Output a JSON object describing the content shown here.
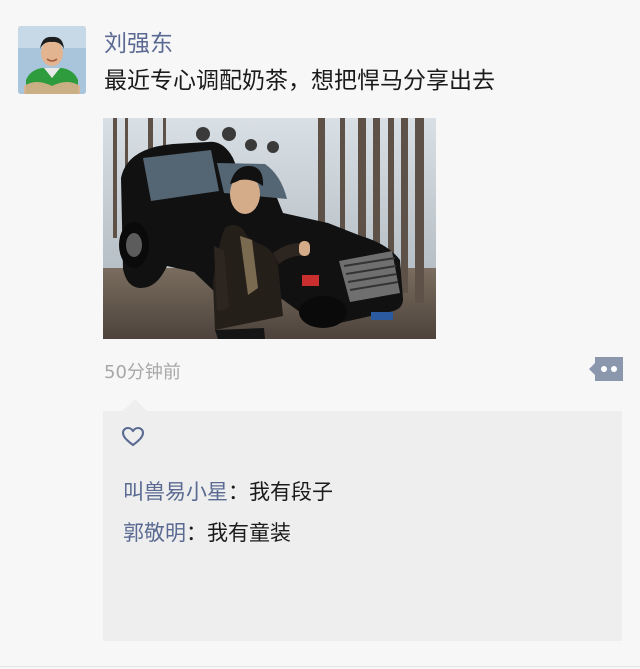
{
  "post": {
    "author": "刘强东",
    "text": "最近专心调配奶茶，想把悍马分享出去",
    "time": "50分钟前"
  },
  "comments": [
    {
      "author": "叫兽易小星",
      "separator": "：",
      "text": "我有段子"
    },
    {
      "author": "郭敬明",
      "separator": "：",
      "text": "我有童装"
    }
  ],
  "colors": {
    "name": "#5a6a92",
    "text": "#1b1b1b",
    "meta": "#a8a8a8",
    "background": "#f7f7f7",
    "comment_bg": "#eeeeee"
  },
  "icons": {
    "like": "heart-icon",
    "more": "more-dots-icon"
  }
}
